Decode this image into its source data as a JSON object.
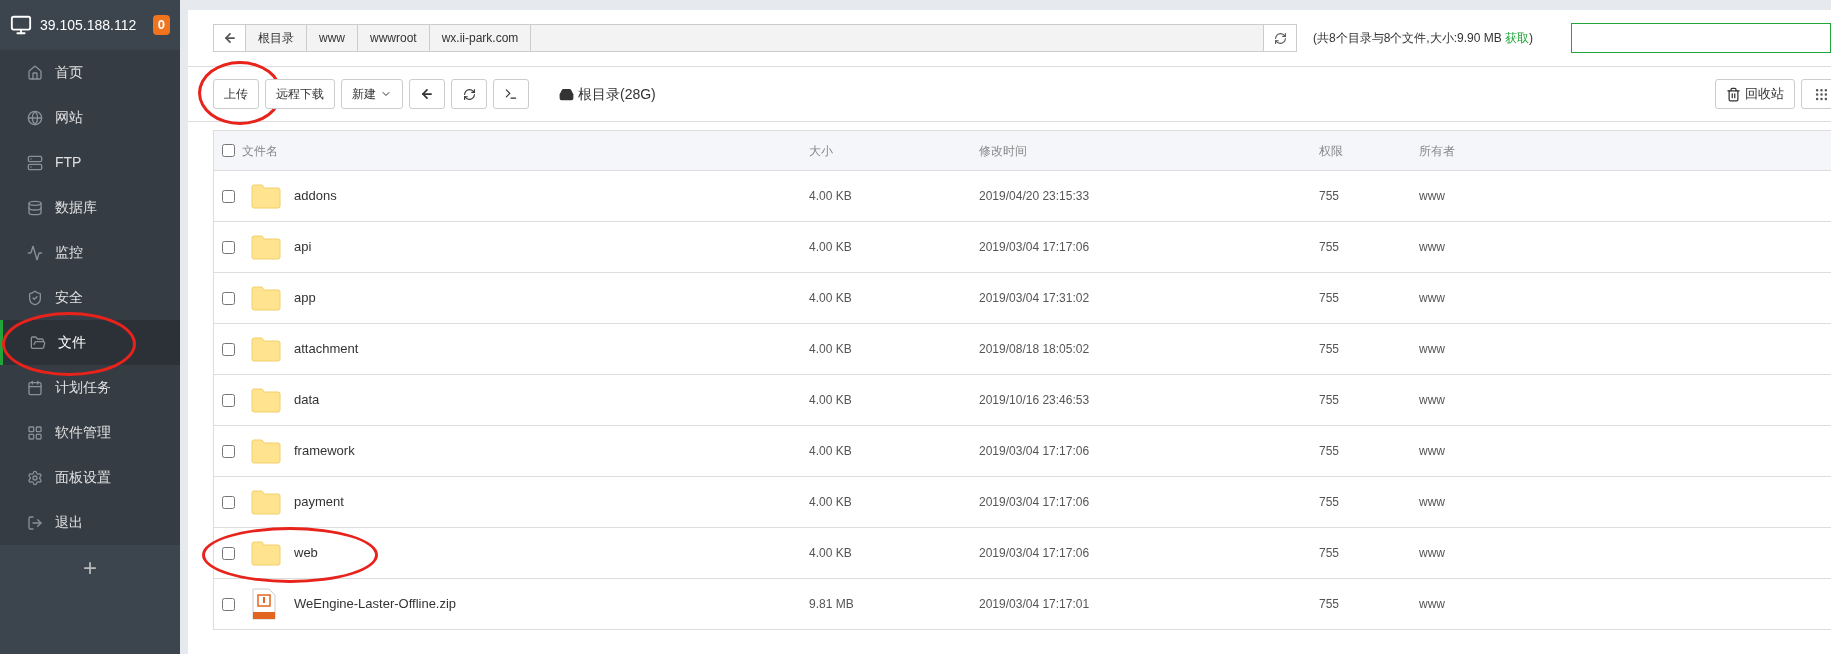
{
  "sidebar": {
    "server": "39.105.188.112",
    "badge": "0",
    "items": [
      {
        "kind": "home",
        "label": "首页",
        "selected": false,
        "circled": false
      },
      {
        "kind": "globe",
        "label": "网站",
        "selected": false,
        "circled": false
      },
      {
        "kind": "ftp",
        "label": "FTP",
        "selected": false,
        "circled": false
      },
      {
        "kind": "db",
        "label": "数据库",
        "selected": false,
        "circled": false
      },
      {
        "kind": "monitor",
        "label": "监控",
        "selected": false,
        "circled": false
      },
      {
        "kind": "shield",
        "label": "安全",
        "selected": false,
        "circled": false
      },
      {
        "kind": "folder",
        "label": "文件",
        "selected": true,
        "circled": true
      },
      {
        "kind": "calendar",
        "label": "计划任务",
        "selected": false,
        "circled": false
      },
      {
        "kind": "grid",
        "label": "软件管理",
        "selected": false,
        "circled": false
      },
      {
        "kind": "gear",
        "label": "面板设置",
        "selected": false,
        "circled": false
      },
      {
        "kind": "logout",
        "label": "退出",
        "selected": false,
        "circled": false
      }
    ],
    "add": "+"
  },
  "breadcrumb": [
    "根目录",
    "www",
    "wwwroot",
    "wx.ii-park.com"
  ],
  "summary": {
    "text": "(共8个目录与8个文件,大小:9.90 MB",
    "link": "获取",
    "close": ")"
  },
  "toolbar": {
    "buttons": [
      {
        "kind": "text",
        "label": "上传",
        "circled": true
      },
      {
        "kind": "text",
        "label": "远程下载",
        "circled": false
      },
      {
        "kind": "dropdown",
        "label": "新建",
        "circled": false
      },
      {
        "kind": "back",
        "circled": false
      },
      {
        "kind": "refresh",
        "circled": false
      },
      {
        "kind": "terminal",
        "circled": false
      }
    ],
    "disk": "根目录(28G)",
    "recycle": "回收站"
  },
  "table": {
    "all_checked": false,
    "columns": [
      "文件名",
      "大小",
      "修改时间",
      "权限",
      "所有者"
    ],
    "rows": [
      {
        "kind": "folder",
        "name": "addons",
        "size": "4.00 KB",
        "mtime": "2019/04/20 23:15:33",
        "perm": "755",
        "owner": "www",
        "checked": false,
        "circled": false
      },
      {
        "kind": "folder",
        "name": "api",
        "size": "4.00 KB",
        "mtime": "2019/03/04 17:17:06",
        "perm": "755",
        "owner": "www",
        "checked": false,
        "circled": false
      },
      {
        "kind": "folder",
        "name": "app",
        "size": "4.00 KB",
        "mtime": "2019/03/04 17:31:02",
        "perm": "755",
        "owner": "www",
        "checked": false,
        "circled": false
      },
      {
        "kind": "folder",
        "name": "attachment",
        "size": "4.00 KB",
        "mtime": "2019/08/18 18:05:02",
        "perm": "755",
        "owner": "www",
        "checked": false,
        "circled": false
      },
      {
        "kind": "folder",
        "name": "data",
        "size": "4.00 KB",
        "mtime": "2019/10/16 23:46:53",
        "perm": "755",
        "owner": "www",
        "checked": false,
        "circled": false
      },
      {
        "kind": "folder",
        "name": "framework",
        "size": "4.00 KB",
        "mtime": "2019/03/04 17:17:06",
        "perm": "755",
        "owner": "www",
        "checked": false,
        "circled": false
      },
      {
        "kind": "folder",
        "name": "payment",
        "size": "4.00 KB",
        "mtime": "2019/03/04 17:17:06",
        "perm": "755",
        "owner": "www",
        "checked": false,
        "circled": false
      },
      {
        "kind": "folder",
        "name": "web",
        "size": "4.00 KB",
        "mtime": "2019/03/04 17:17:06",
        "perm": "755",
        "owner": "www",
        "checked": false,
        "circled": true
      },
      {
        "kind": "zip",
        "name": "WeEngine-Laster-Offline.zip",
        "size": "9.81 MB",
        "mtime": "2019/03/04 17:17:01",
        "perm": "755",
        "owner": "www",
        "checked": false,
        "circled": false
      }
    ]
  }
}
